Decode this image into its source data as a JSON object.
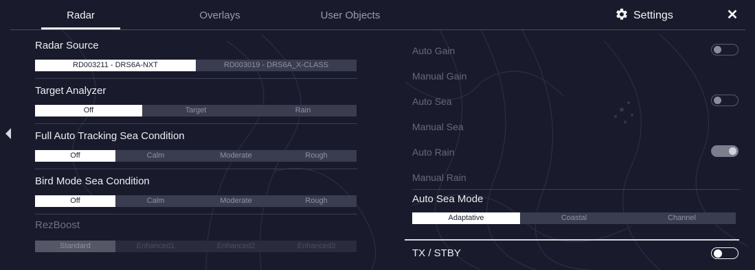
{
  "tabs": [
    "Radar",
    "Overlays",
    "User Objects"
  ],
  "settings_label": "Settings",
  "close_glyph": "✕",
  "left": {
    "radar_source": {
      "label": "Radar Source",
      "options": [
        "RD003211 - DRS6A-NXT",
        "RD003019 - DRS6A_X-CLASS"
      ],
      "selected": 0
    },
    "target_analyzer": {
      "label": "Target Analyzer",
      "options": [
        "Off",
        "Target",
        "Rain"
      ],
      "selected": 0
    },
    "full_auto_tracking": {
      "label": "Full Auto Tracking Sea Condition",
      "options": [
        "Off",
        "Calm",
        "Moderate",
        "Rough"
      ],
      "selected": 0
    },
    "bird_mode": {
      "label": "Bird Mode Sea Condition",
      "options": [
        "Off",
        "Calm",
        "Moderate",
        "Rough"
      ],
      "selected": 0
    },
    "rezboost": {
      "label": "RezBoost",
      "options": [
        "Standard",
        "Enhanced1",
        "Enhanced2",
        "Enhanced3"
      ],
      "selected": 0,
      "enabled": false
    }
  },
  "right": {
    "auto_gain": {
      "label": "Auto Gain",
      "on": false
    },
    "manual_gain": {
      "label": "Manual Gain"
    },
    "auto_sea": {
      "label": "Auto Sea",
      "on": false
    },
    "manual_sea": {
      "label": "Manual Sea"
    },
    "auto_rain": {
      "label": "Auto Rain",
      "on": true
    },
    "manual_rain": {
      "label": "Manual Rain"
    },
    "auto_sea_mode": {
      "label": "Auto Sea Mode",
      "options": [
        "Adaptative",
        "Coastal",
        "Channel"
      ],
      "selected": 0
    },
    "tx_stby": {
      "label": "TX / STBY",
      "on": false
    }
  },
  "colors": {
    "background": "#191b2c",
    "selected_option": "#ffffff",
    "segment": "#3a3c50"
  },
  "icons": {
    "settings": "gear-icon",
    "close": "close-icon",
    "collapse": "chevron-left-icon"
  }
}
